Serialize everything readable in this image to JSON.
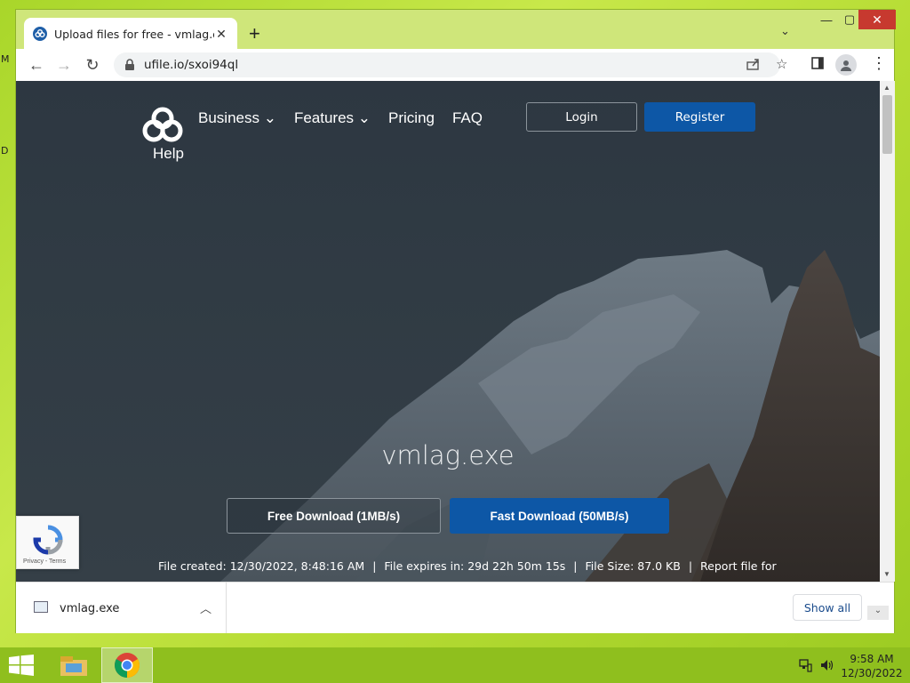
{
  "desktop": {
    "left_edge_letters": [
      "M",
      "D"
    ]
  },
  "browser": {
    "tab": {
      "title": "Upload files for free - vmlag.exe",
      "close": "✕"
    },
    "new_tab": "+",
    "tab_search": "⌄",
    "window_controls": {
      "minimize": "—",
      "maximize": "▢",
      "close": "✕"
    },
    "nav": {
      "back": "←",
      "forward": "→",
      "reload": "↻"
    },
    "address": {
      "url": "ufile.io/sxoi94ql"
    }
  },
  "site": {
    "help_label": "Help",
    "menu": [
      {
        "label": "Business ⌄"
      },
      {
        "label": "Features ⌄"
      },
      {
        "label": "Pricing"
      },
      {
        "label": "FAQ"
      }
    ],
    "login_label": "Login",
    "register_label": "Register",
    "file_name": "vmlag.exe",
    "free_download_label": "Free Download (1MB/s)",
    "fast_download_label": "Fast Download (50MB/s)",
    "meta": {
      "created": "File created: 12/30/2022, 8:48:16 AM",
      "expires": "File expires in: 29d 22h 50m 15s",
      "size": "File Size: 87.0 KB",
      "report": "Report file for",
      "separator": "|"
    },
    "recaptcha_text": "Privacy - Terms"
  },
  "downloads": {
    "item_name": "vmlag.exe",
    "show_all_label": "Show all"
  },
  "taskbar": {
    "time": "9:58 AM",
    "date": "12/30/2022"
  },
  "colors": {
    "accent_blue": "#0d57a6",
    "desktop_green": "#a9d62a",
    "taskbar_green": "#8fbf1e"
  }
}
